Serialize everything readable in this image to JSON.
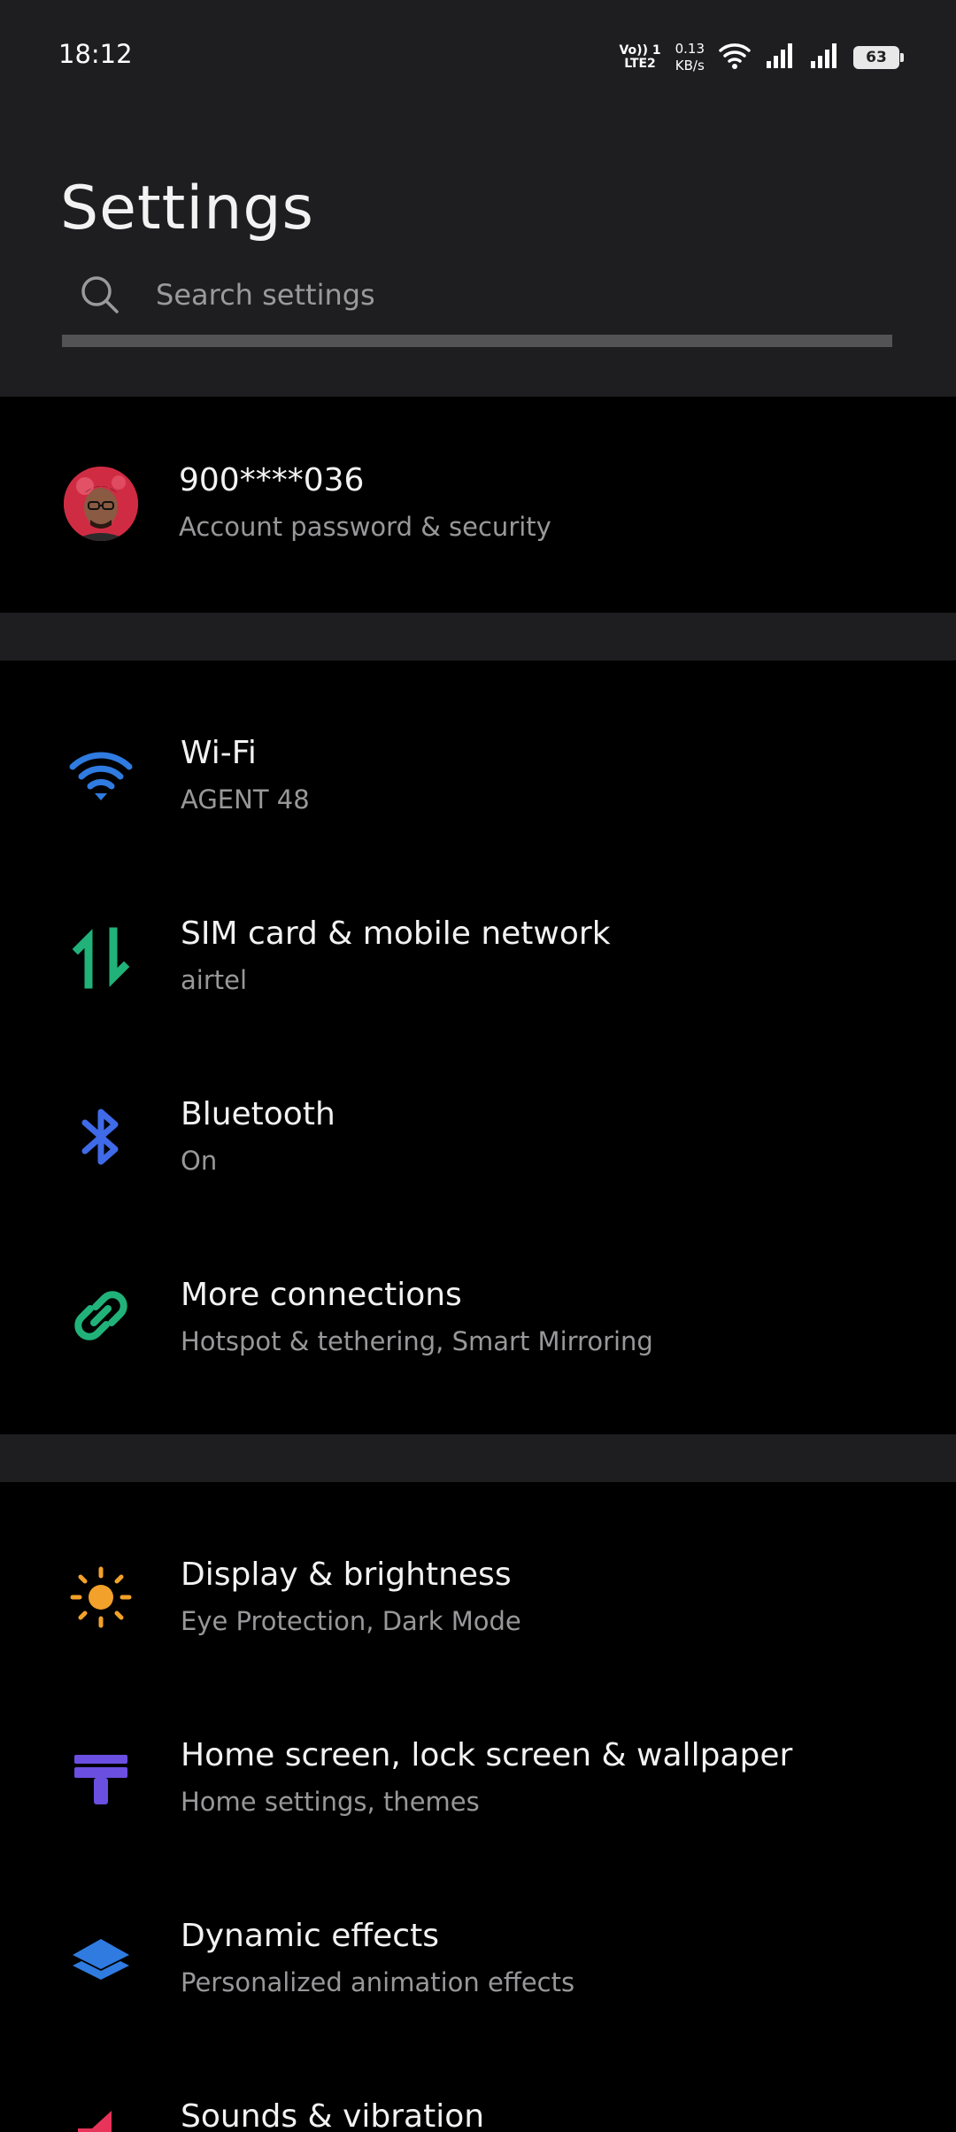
{
  "status_bar": {
    "time": "18:12",
    "volte_line1": "Vo)) 1",
    "volte_line2": "LTE2",
    "speed_value": "0.13",
    "speed_unit": "KB/s",
    "battery_level": "63"
  },
  "header": {
    "title": "Settings"
  },
  "search": {
    "placeholder": "Search settings",
    "value": ""
  },
  "account": {
    "name": "900****036",
    "subtitle": "Account password & security"
  },
  "settings_items": [
    {
      "title": "Wi-Fi",
      "subtitle": "AGENT 48",
      "icon": "wifi-icon",
      "color": "#2f7be0"
    },
    {
      "title": "SIM card & mobile network",
      "subtitle": "airtel",
      "icon": "mobile-data-icon",
      "color": "#21b27a"
    },
    {
      "title": "Bluetooth",
      "subtitle": "On",
      "icon": "bluetooth-icon",
      "color": "#3f6ae8"
    },
    {
      "title": "More connections",
      "subtitle": "Hotspot & tethering, Smart Mirroring",
      "icon": "link-icon",
      "color": "#21b27a"
    },
    {
      "title": "Display & brightness",
      "subtitle": "Eye Protection, Dark Mode",
      "icon": "sun-icon",
      "color": "#f2a12a"
    },
    {
      "title": "Home screen, lock screen & wallpaper",
      "subtitle": "Home settings, themes",
      "icon": "theme-brush-icon",
      "color": "#6a4fe0"
    },
    {
      "title": "Dynamic effects",
      "subtitle": "Personalized animation effects",
      "icon": "layers-icon",
      "color": "#2f7be0"
    },
    {
      "title": "Sounds & vibration",
      "subtitle": "",
      "icon": "sound-icon",
      "color": "#e8345a"
    }
  ],
  "colors": {
    "header_background": "#1e1e20",
    "list_background": "#000000",
    "primary_text": "#f2f2f2",
    "secondary_text": "#98989a"
  }
}
